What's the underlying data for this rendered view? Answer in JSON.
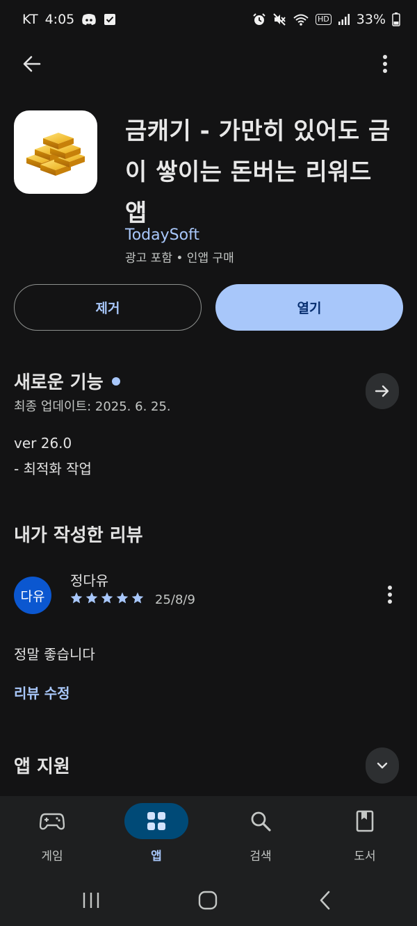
{
  "status_bar": {
    "carrier": "KT",
    "time": "4:05",
    "battery": "33%",
    "hd_label": "HD"
  },
  "app": {
    "title": "금캐기 - 가만히 있어도 금이 쌓이는 돈버는 리워드 앱",
    "developer": "TodaySoft",
    "meta": "광고 포함 • 인앱 구매",
    "icon": "gold-bars-icon"
  },
  "actions": {
    "uninstall_label": "제거",
    "open_label": "열기"
  },
  "whats_new": {
    "title": "새로운 기능",
    "last_update": "최종 업데이트: 2025. 6. 25.",
    "notes": [
      "ver 26.0",
      "- 최적화 작업"
    ]
  },
  "my_review": {
    "title": "내가 작성한 리뷰",
    "avatar_text": "다유",
    "reviewer_name": "정다유",
    "rating": 5,
    "date": "25/8/9",
    "text": "정말 좋습니다",
    "edit_label": "리뷰 수정"
  },
  "app_support": {
    "title": "앱 지원"
  },
  "bottom_nav": {
    "items": [
      {
        "label": "게임",
        "icon": "gamepad-icon",
        "active": false
      },
      {
        "label": "앱",
        "icon": "apps-grid-icon",
        "active": true
      },
      {
        "label": "검색",
        "icon": "search-icon",
        "active": false
      },
      {
        "label": "도서",
        "icon": "bookmark-book-icon",
        "active": false
      }
    ]
  },
  "colors": {
    "background": "#131314",
    "accent": "#a8c7fa",
    "active_pill": "#004a77",
    "avatar": "#0b57d0"
  }
}
